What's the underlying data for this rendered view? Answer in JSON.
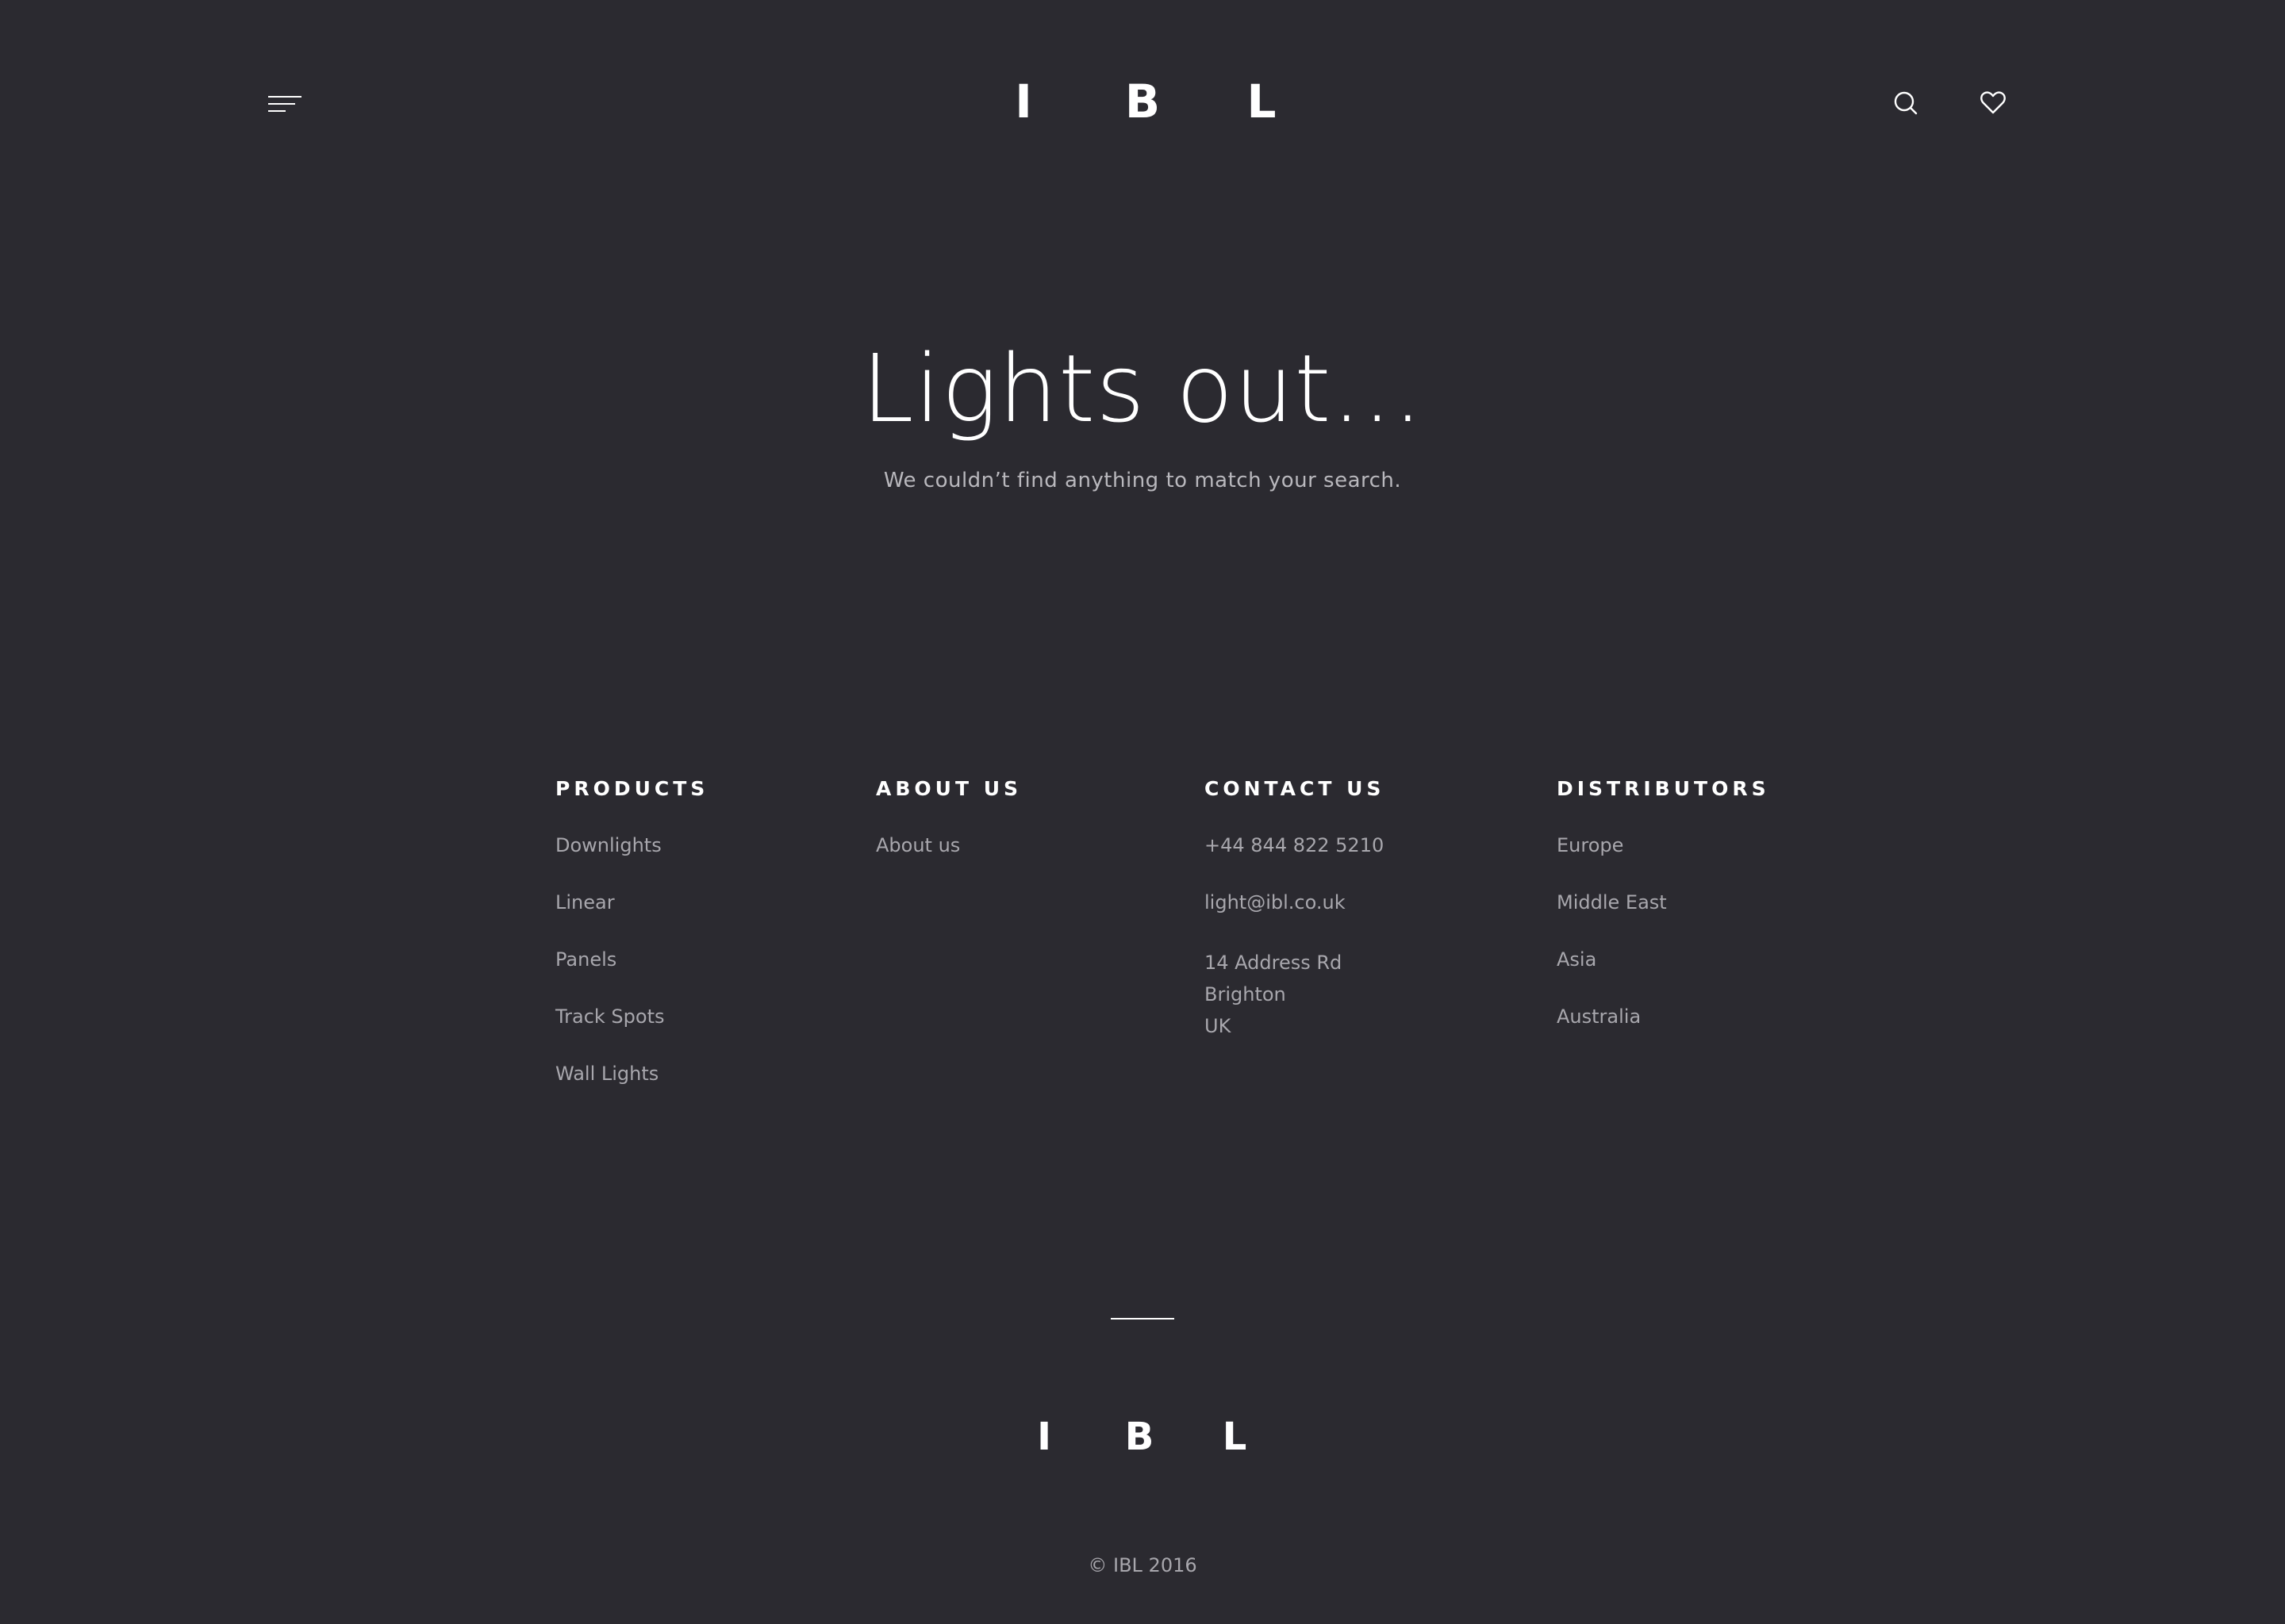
{
  "header": {
    "menu_icon": "hamburger-menu-icon",
    "logo_letters": [
      "I",
      "B",
      "L"
    ],
    "search_icon": "search-icon",
    "favorites_icon": "heart-icon"
  },
  "hero": {
    "title": "Lights out...",
    "subtitle": "We couldn’t find anything to match your search."
  },
  "footer": {
    "products": {
      "heading": "PRODUCTS",
      "items": [
        "Downlights",
        "Linear",
        "Panels",
        "Track Spots",
        "Wall Lights"
      ]
    },
    "about": {
      "heading": "ABOUT US",
      "items": [
        "About us"
      ]
    },
    "contact": {
      "heading": "CONTACT US",
      "phone": "+44 844 822 5210",
      "email": "light@ibl.co.uk",
      "address": [
        "14 Address Rd",
        "Brighton",
        "UK"
      ]
    },
    "distributors": {
      "heading": "DISTRIBUTORS",
      "items": [
        "Europe",
        "Middle East",
        "Asia",
        "Australia"
      ]
    },
    "logo_letters": [
      "I",
      "B",
      "L"
    ],
    "copyright": "© IBL 2016"
  },
  "colors": {
    "background": "#2b2a30",
    "text_primary": "#ffffff",
    "text_muted": "#a8a7ad"
  }
}
